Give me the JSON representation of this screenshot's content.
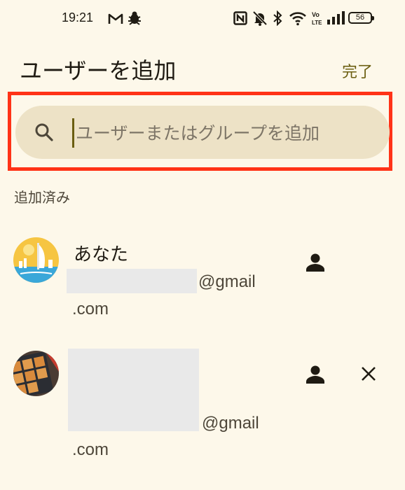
{
  "status_bar": {
    "time": "19:21",
    "battery": "56",
    "icons": [
      "gmail-icon",
      "bug-notification-icon",
      "nfc-icon",
      "mute-icon",
      "bluetooth-icon",
      "wifi-icon",
      "volte-icon",
      "signal-icon",
      "battery-icon"
    ]
  },
  "header": {
    "title": "ユーザーを追加",
    "done_label": "完了"
  },
  "search": {
    "placeholder": "ユーザーまたはグループを追加",
    "value": ""
  },
  "section": {
    "label": "追加済み"
  },
  "users": [
    {
      "name": "あなた",
      "email_suffix": "@gmail",
      "email_domain_end": ".com",
      "role_icon": "person-icon",
      "removable": false
    },
    {
      "name": "",
      "email_suffix": "@gmail",
      "email_domain_end": ".com",
      "role_icon": "person-icon",
      "removable": true
    }
  ],
  "colors": {
    "background": "#fdf8ea",
    "search_background": "#ede2c6",
    "accent": "#6b5e10",
    "highlight": "#ff3317"
  }
}
